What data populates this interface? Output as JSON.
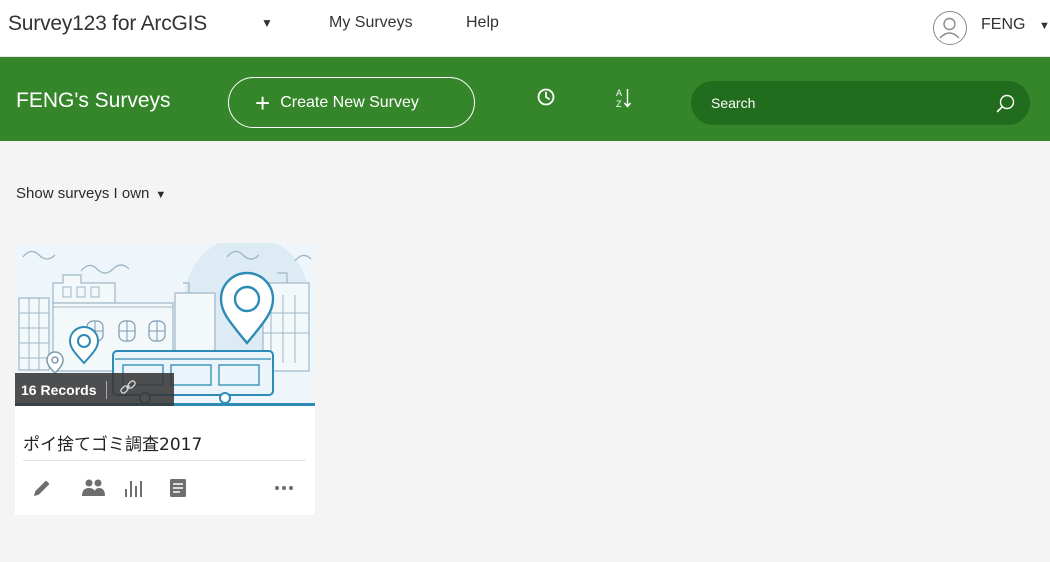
{
  "topbar": {
    "app_title": "Survey123 for ArcGIS",
    "nav": [
      {
        "label": "My Surveys"
      },
      {
        "label": "Help"
      }
    ],
    "user_name": "FENG"
  },
  "header": {
    "owner_title": "FENG's Surveys",
    "create_button": "Create New Survey",
    "search_placeholder": "Search"
  },
  "filter": {
    "label": "Show surveys I own"
  },
  "surveys": [
    {
      "records_label": "16 Records",
      "title": "ポイ捨てゴミ調査2017"
    }
  ],
  "colors": {
    "brand_green": "#35862b",
    "search_green": "#226c1d",
    "background": "#f4f4f4",
    "icon_gray": "#6e6e6e"
  },
  "icons": {
    "app_menu": "caret-down-icon",
    "user": "user-avatar-icon",
    "clock": "clock-icon",
    "sort": "sort-az-icon",
    "search": "search-icon",
    "link": "link-icon",
    "actions": [
      "edit-icon",
      "people-icon",
      "analyze-icon",
      "data-icon",
      "more-icon"
    ]
  }
}
